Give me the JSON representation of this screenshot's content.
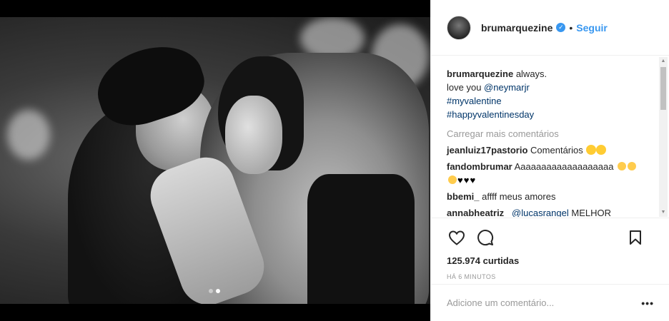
{
  "post": {
    "username": "brumarquezine",
    "verified_icon": "verified-badge-icon",
    "separator": "•",
    "follow_label": "Seguir",
    "caption_text": "always.",
    "caption_line2_prefix": "love you ",
    "caption_mention": "@neymarjr",
    "hashtag1": "#myvalentine",
    "hashtag2": "#happyvalentinesday",
    "load_more": "Carregar mais comentários",
    "comments": [
      {
        "user": "jeanluiz17pastorio",
        "text": "Comentários"
      },
      {
        "user": "fandombrumar",
        "text": "Aaaaaaaaaaaaaaaaaaa"
      },
      {
        "user": "bbemi_",
        "text": "affff meus amores"
      },
      {
        "user": "annabheatriz_",
        "mention": "@lucasrangel",
        "text": "MELHOR"
      }
    ],
    "likes": "125.974 curtidas",
    "time": "HÁ 6 MINUTOS",
    "add_comment_placeholder": "Adicione um comentário...",
    "more_options": "•••"
  },
  "icons": {
    "like": "heart-icon",
    "comment": "comment-icon",
    "save": "bookmark-icon"
  },
  "colors": {
    "link": "#003569",
    "follow": "#3897f0",
    "muted": "#999999"
  }
}
